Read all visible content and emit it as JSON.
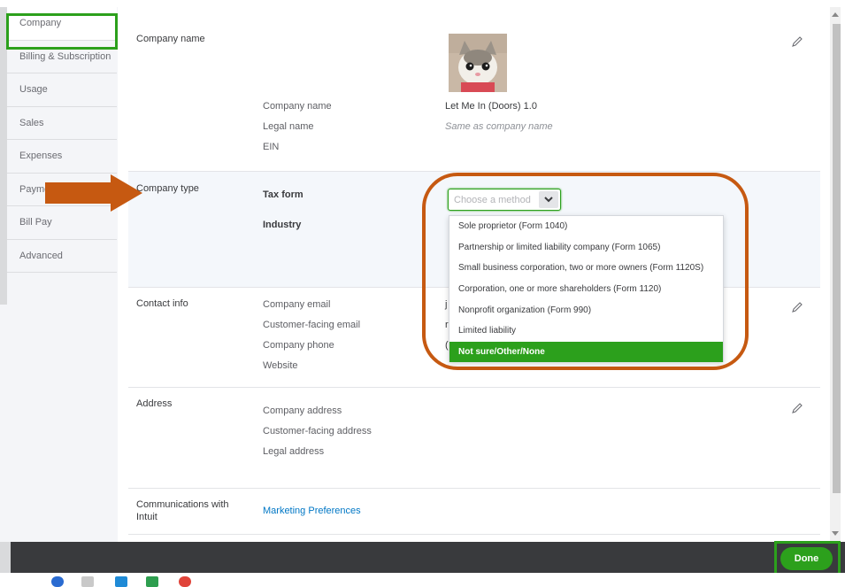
{
  "sidebar": {
    "items": [
      {
        "label": "Company",
        "active": true
      },
      {
        "label": "Billing & Subscription"
      },
      {
        "label": "Usage"
      },
      {
        "label": "Sales"
      },
      {
        "label": "Expenses"
      },
      {
        "label": "Payme"
      },
      {
        "label": "Bill Pay"
      },
      {
        "label": "Advanced"
      }
    ]
  },
  "company_name_section": {
    "title": "Company name",
    "logo": "cat-photo-logo",
    "fields": [
      {
        "label": "Company name",
        "value": "Let Me In (Doors) 1.0"
      },
      {
        "label": "Legal name",
        "value": "Same as company name"
      },
      {
        "label": "EIN",
        "value": ""
      }
    ]
  },
  "company_type_section": {
    "title": "Company type",
    "tax_form_label": "Tax form",
    "industry_label": "Industry",
    "select_placeholder": "Choose a method",
    "options": [
      "Sole proprietor (Form 1040)",
      "Partnership or limited liability company (Form 1065)",
      "Small business corporation, two or more owners (Form 1120S)",
      "Corporation, one or more shareholders (Form 1120)",
      "Nonprofit organization (Form 990)",
      "Limited liability",
      "Not sure/Other/None"
    ],
    "highlighted_option": "Not sure/Other/None"
  },
  "contact_section": {
    "title": "Contact info",
    "labels": [
      "Company email",
      "Customer-facing email",
      "Company phone",
      "Website"
    ],
    "partial_values": [
      "j",
      "r",
      "("
    ]
  },
  "address_section": {
    "title": "Address",
    "labels": [
      "Company address",
      "Customer-facing address",
      "Legal address"
    ]
  },
  "communications_section": {
    "title_line1": "Communications with",
    "title_line2": "Intuit",
    "link": "Marketing Preferences"
  },
  "footer": {
    "done_label": "Done"
  },
  "colors": {
    "accent_green": "#2ca01c",
    "annotation_orange": "#c65911",
    "link_blue": "#0077c5",
    "footer_dark": "#393a3d"
  },
  "icons": [
    "pencil-icon",
    "chevron-down-icon",
    "arrow-annotation"
  ]
}
